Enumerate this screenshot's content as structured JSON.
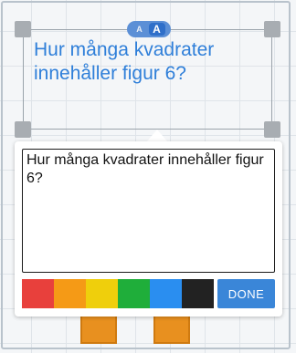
{
  "canvas": {
    "text_box": {
      "text": "Hur många kvadrater innehåller figur 6?",
      "color": "#2f7fd9"
    },
    "font_toggle": {
      "small_label": "A",
      "large_label": "A"
    },
    "tile_color": "#e8901f"
  },
  "editor": {
    "value": "Hur många kvadrater innehåller figur 6?",
    "palette": [
      {
        "name": "red",
        "color": "#e8403c"
      },
      {
        "name": "orange",
        "color": "#f59a16"
      },
      {
        "name": "yellow",
        "color": "#efcf0c"
      },
      {
        "name": "green",
        "color": "#1fae3a"
      },
      {
        "name": "blue",
        "color": "#2a8ef0"
      },
      {
        "name": "black",
        "color": "#222222"
      }
    ],
    "done_label": "DONE"
  }
}
